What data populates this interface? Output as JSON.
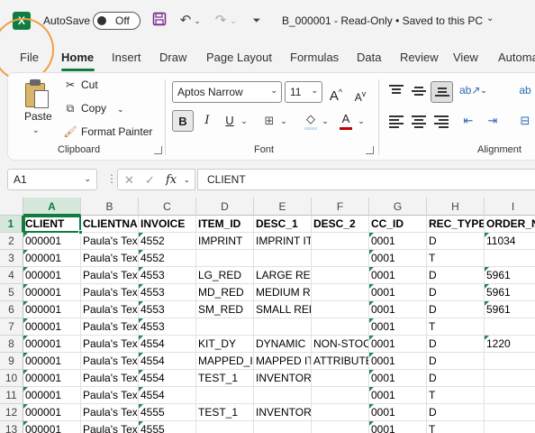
{
  "titlebar": {
    "app_logo": "X",
    "autosave_label": "AutoSave",
    "autosave_state": "Off",
    "title": "B_000001  -  Read-Only  •  Saved to this PC",
    "icons": [
      "save-icon",
      "undo-icon",
      "redo-icon",
      "customize-qat-icon",
      "chevron-down-icon"
    ]
  },
  "tabs": [
    "File",
    "Home",
    "Insert",
    "Draw",
    "Page Layout",
    "Formulas",
    "Data",
    "Review",
    "View",
    "Automa"
  ],
  "active_tab": "Home",
  "ribbon": {
    "clipboard": {
      "group_label": "Clipboard",
      "paste": "Paste",
      "cut": "Cut",
      "copy": "Copy",
      "format_painter": "Format Painter"
    },
    "font": {
      "group_label": "Font",
      "font_name": "Aptos Narrow",
      "font_size": "11",
      "bold": "B",
      "italic": "I",
      "underline": "U",
      "font_color_letter": "A",
      "font_color": "#c00000",
      "grow": "A",
      "shrink": "A"
    },
    "alignment": {
      "group_label": "Alignment"
    }
  },
  "formula_bar": {
    "name_box": "A1",
    "fx": "fx",
    "content": "CLIENT"
  },
  "colors": {
    "accent": "#107c41",
    "highlight_circle": "#f0a040"
  },
  "sheet": {
    "selected_cell": "A1",
    "columns": [
      "A",
      "B",
      "C",
      "D",
      "E",
      "F",
      "G",
      "H",
      "I"
    ],
    "rows": [
      {
        "n": "1",
        "cells": [
          "CLIENT",
          "CLIENTNAME",
          "INVOICE",
          "ITEM_ID",
          "DESC_1",
          "DESC_2",
          "CC_ID",
          "REC_TYPE",
          "ORDER_NO"
        ]
      },
      {
        "n": "2",
        "cells": [
          "000001",
          "Paula's Texas",
          "4552",
          "IMPRINT",
          "IMPRINT ITEM",
          "",
          "0001",
          "D",
          "11034"
        ]
      },
      {
        "n": "3",
        "cells": [
          "000001",
          "Paula's Texas",
          "4552",
          "",
          "",
          "",
          "0001",
          "T",
          ""
        ]
      },
      {
        "n": "4",
        "cells": [
          "000001",
          "Paula's Texas",
          "4553",
          "LG_RED",
          "LARGE RED",
          "",
          "0001",
          "D",
          "5961"
        ]
      },
      {
        "n": "5",
        "cells": [
          "000001",
          "Paula's Texas",
          "4553",
          "MD_RED",
          "MEDIUM RED",
          "",
          "0001",
          "D",
          "5961"
        ]
      },
      {
        "n": "6",
        "cells": [
          "000001",
          "Paula's Texas",
          "4553",
          "SM_RED",
          "SMALL RED",
          "",
          "0001",
          "D",
          "5961"
        ]
      },
      {
        "n": "7",
        "cells": [
          "000001",
          "Paula's Texas",
          "4553",
          "",
          "",
          "",
          "0001",
          "T",
          ""
        ]
      },
      {
        "n": "8",
        "cells": [
          "000001",
          "Paula's Texas",
          "4554",
          "KIT_DY",
          "DYNAMIC",
          "NON-STOCK",
          "0001",
          "D",
          "1220"
        ]
      },
      {
        "n": "9",
        "cells": [
          "000001",
          "Paula's Texas",
          "4554",
          "MAPPED_I",
          "MAPPED ITEM",
          "ATTRIBUTE",
          "0001",
          "D",
          ""
        ]
      },
      {
        "n": "10",
        "cells": [
          "000001",
          "Paula's Texas",
          "4554",
          "TEST_1",
          "INVENTORY",
          "",
          "0001",
          "D",
          ""
        ]
      },
      {
        "n": "11",
        "cells": [
          "000001",
          "Paula's Texas",
          "4554",
          "",
          "",
          "",
          "0001",
          "T",
          ""
        ]
      },
      {
        "n": "12",
        "cells": [
          "000001",
          "Paula's Texas",
          "4555",
          "TEST_1",
          "INVENTORY",
          "",
          "0001",
          "D",
          ""
        ]
      },
      {
        "n": "13",
        "cells": [
          "000001",
          "Paula's Texas",
          "4555",
          "",
          "",
          "",
          "0001",
          "T",
          ""
        ]
      }
    ]
  }
}
